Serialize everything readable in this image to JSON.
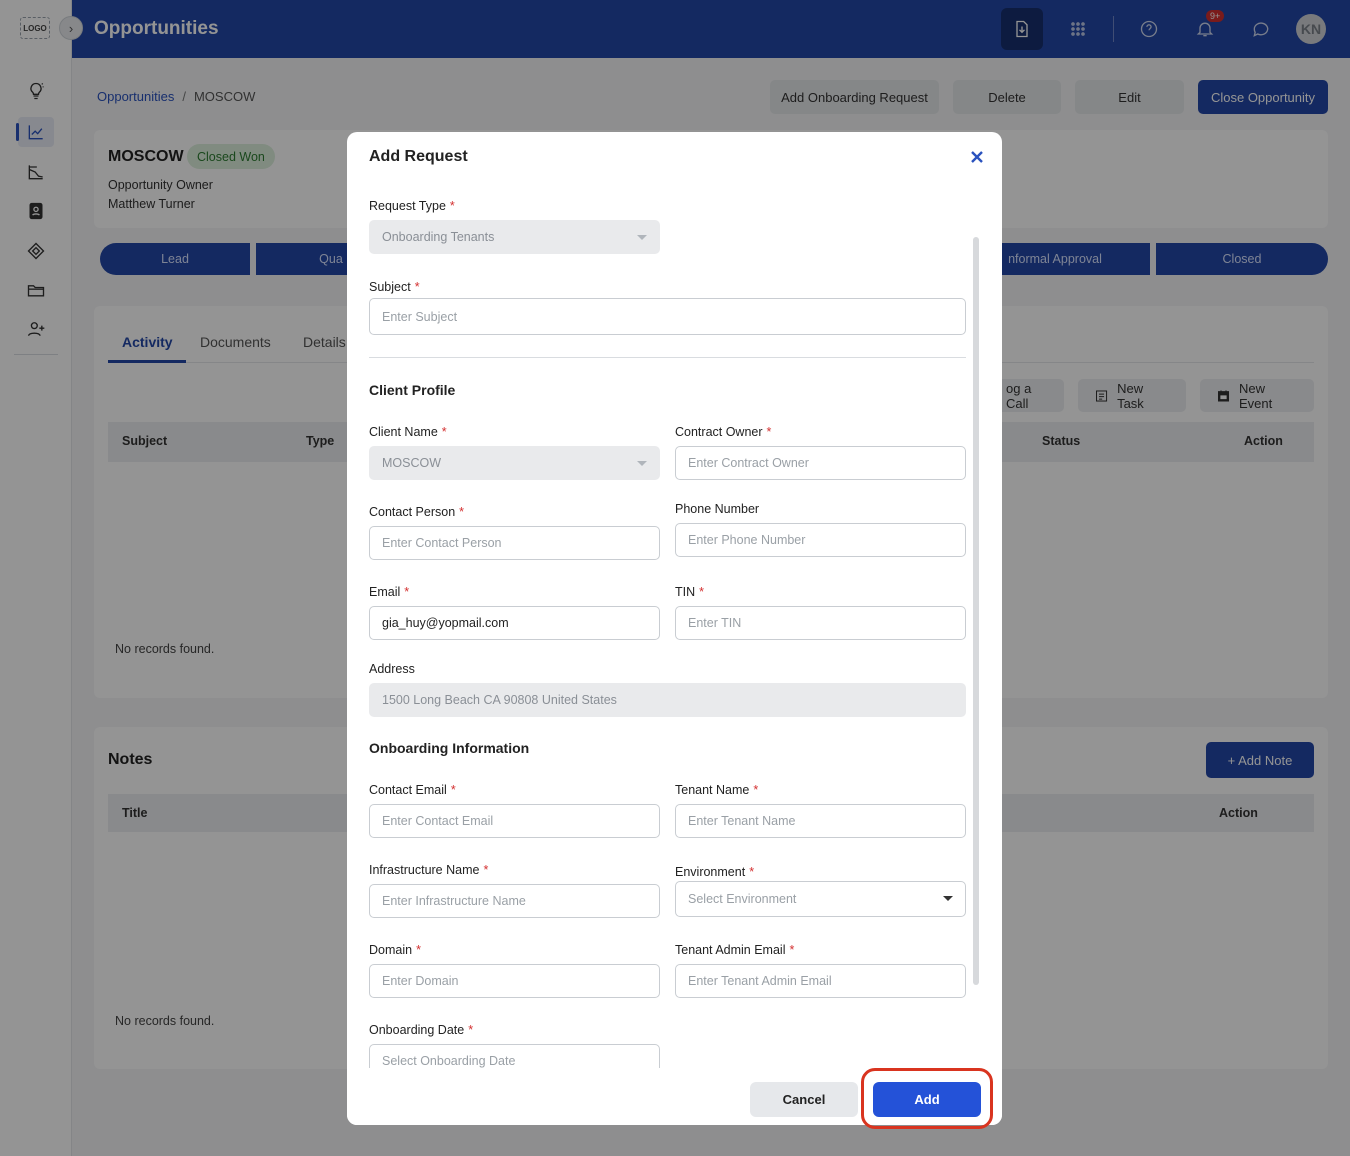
{
  "app": {
    "logo_text": "LOGO",
    "page_title": "Opportunities",
    "notif_count": "9+",
    "avatar_initials": "KN"
  },
  "breadcrumb": {
    "parent": "Opportunities",
    "separator": "/",
    "current": "MOSCOW"
  },
  "header_actions": {
    "add_onboarding": "Add Onboarding Request",
    "delete": "Delete",
    "edit": "Edit",
    "close_opportunity": "Close Opportunity"
  },
  "opportunity": {
    "name": "MOSCOW",
    "status": "Closed Won",
    "owner_label": "Opportunity Owner",
    "owner_name": "Matthew Turner"
  },
  "stages": [
    "Lead",
    "Qua",
    "nformal Approval",
    "Closed"
  ],
  "tabs": [
    "Activity",
    "Documents",
    "Details"
  ],
  "activity": {
    "log_call": "og a Call",
    "new_task": "New Task",
    "new_event": "New Event",
    "columns": {
      "subject": "Subject",
      "type": "Type",
      "status": "Status",
      "action": "Action"
    },
    "empty": "No records found."
  },
  "notes": {
    "title": "Notes",
    "add_note": "+ Add Note",
    "columns": {
      "title": "Title",
      "action": "Action"
    },
    "empty": "No records found."
  },
  "modal": {
    "title": "Add Request",
    "request_type": {
      "label": "Request Type",
      "value": "Onboarding Tenants"
    },
    "subject": {
      "label": "Subject",
      "placeholder": "Enter Subject"
    },
    "client_profile_title": "Client Profile",
    "client_name": {
      "label": "Client Name",
      "value": "MOSCOW"
    },
    "contract_owner": {
      "label": "Contract Owner",
      "placeholder": "Enter Contract Owner"
    },
    "contact_person": {
      "label": "Contact Person",
      "placeholder": "Enter Contact Person"
    },
    "phone": {
      "label": "Phone Number",
      "placeholder": "Enter Phone Number"
    },
    "email": {
      "label": "Email",
      "value": "gia_huy@yopmail.com"
    },
    "tin": {
      "label": "TIN",
      "placeholder": "Enter TIN"
    },
    "address": {
      "label": "Address",
      "value": "1500  Long Beach CA 90808 United States"
    },
    "onboarding_title": "Onboarding Information",
    "contact_email": {
      "label": "Contact Email",
      "placeholder": "Enter Contact Email"
    },
    "tenant_name": {
      "label": "Tenant Name",
      "placeholder": "Enter Tenant Name"
    },
    "infra_name": {
      "label": "Infrastructure Name",
      "placeholder": "Enter Infrastructure Name"
    },
    "environment": {
      "label": "Environment",
      "placeholder": "Select Environment"
    },
    "domain": {
      "label": "Domain",
      "placeholder": "Enter Domain"
    },
    "tenant_admin_email": {
      "label": "Tenant Admin Email",
      "placeholder": "Enter Tenant Admin Email"
    },
    "onboarding_date": {
      "label": "Onboarding Date",
      "placeholder": "Select Onboarding Date"
    },
    "required_mark": "*",
    "cancel": "Cancel",
    "add": "Add"
  },
  "colors": {
    "brand": "#2448a8",
    "primary_button": "#2452d8",
    "highlight": "#d9341f",
    "status_bg": "#dcefdc"
  }
}
